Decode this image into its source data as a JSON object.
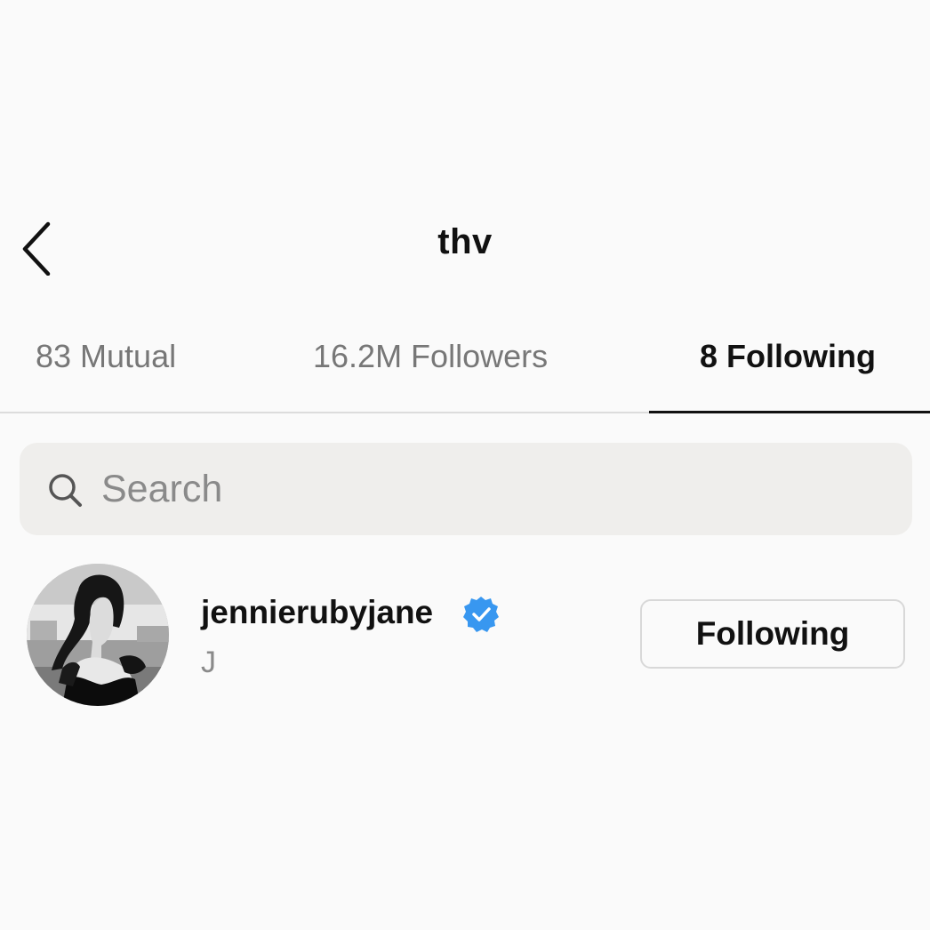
{
  "header": {
    "title": "thv",
    "back_icon": "chevron-left-icon"
  },
  "tabs": [
    {
      "label": "83 Mutual",
      "active": false
    },
    {
      "label": "16.2M Followers",
      "active": false
    },
    {
      "label": "8 Following",
      "active": true
    }
  ],
  "search": {
    "placeholder": "Search",
    "value": "",
    "icon": "search-icon"
  },
  "list": [
    {
      "username": "jennierubyjane",
      "full_name": "J",
      "verified": true,
      "button_label": "Following"
    }
  ],
  "colors": {
    "background": "#fafafa",
    "search_background": "#efeeec",
    "verified_badge": "#3897f0",
    "secondary_text": "#777777"
  }
}
